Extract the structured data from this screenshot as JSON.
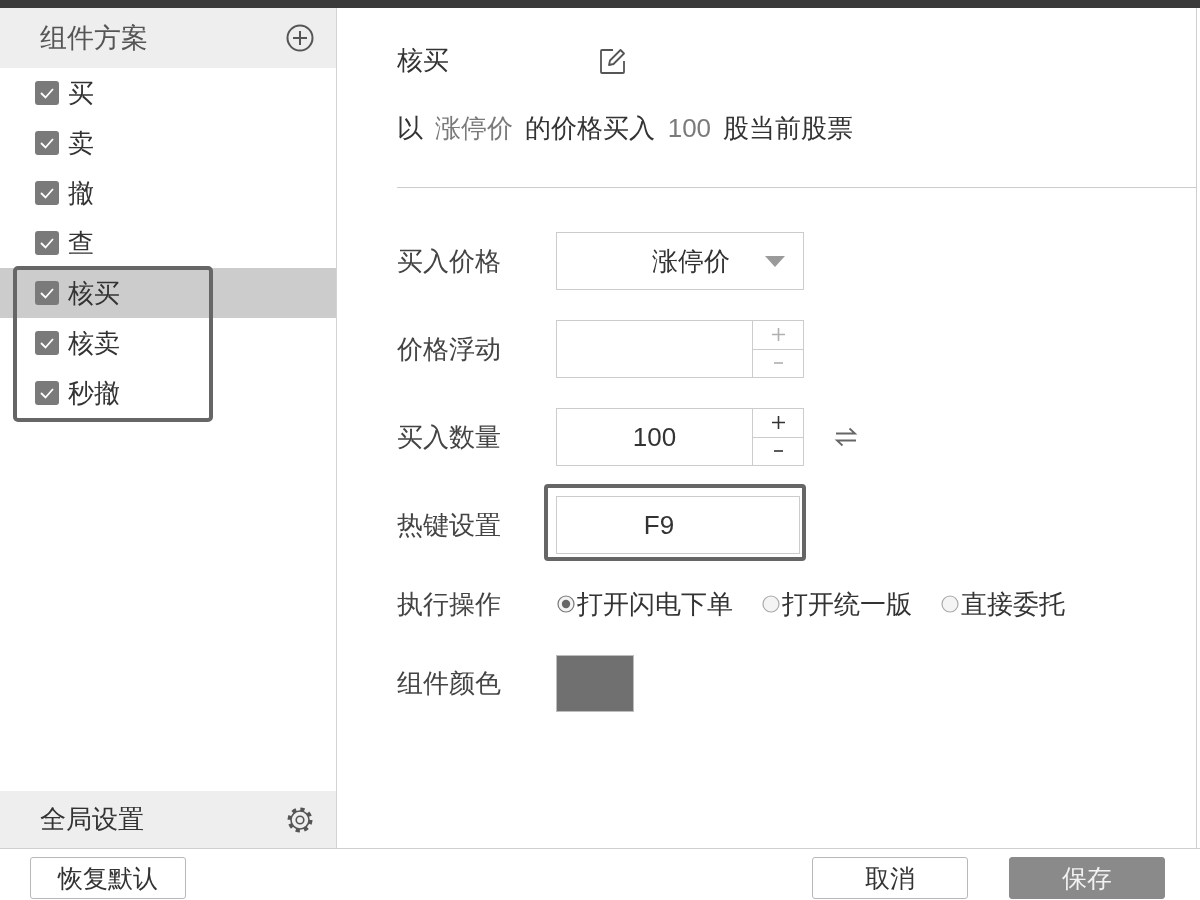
{
  "sidebar": {
    "title": "组件方案",
    "items": [
      {
        "label": "买",
        "checked": true,
        "selected": false,
        "highlighted": false
      },
      {
        "label": "卖",
        "checked": true,
        "selected": false,
        "highlighted": false
      },
      {
        "label": "撤",
        "checked": true,
        "selected": false,
        "highlighted": false
      },
      {
        "label": "查",
        "checked": true,
        "selected": false,
        "highlighted": false
      },
      {
        "label": "核买",
        "checked": true,
        "selected": true,
        "highlighted": true
      },
      {
        "label": "核卖",
        "checked": true,
        "selected": false,
        "highlighted": true
      },
      {
        "label": "秒撤",
        "checked": true,
        "selected": false,
        "highlighted": true
      }
    ],
    "footer": {
      "label": "全局设置"
    }
  },
  "panel": {
    "title": "核买",
    "description": [
      {
        "kind": "text",
        "text": "以 "
      },
      {
        "kind": "value",
        "text": "涨停价"
      },
      {
        "kind": "text",
        "text": " 的价格买入 "
      },
      {
        "kind": "value",
        "text": "100"
      },
      {
        "kind": "text",
        "text": " 股当前股票"
      }
    ],
    "fields": [
      {
        "kind": "dropdown",
        "label": "买入价格",
        "value": "涨停价"
      },
      {
        "kind": "spinner",
        "label": "价格浮动",
        "disabled": true
      },
      {
        "kind": "spinner",
        "label": "买入数量",
        "value": "100",
        "disabled": false,
        "swap": true
      },
      {
        "kind": "hotkey",
        "label": "热键设置",
        "value": "F9",
        "highlighted": true
      },
      {
        "kind": "radio",
        "label": "执行操作",
        "options": [
          {
            "label": "打开闪电下单",
            "selected": true
          },
          {
            "label": "打开统一版",
            "selected": false
          },
          {
            "label": "直接委托",
            "selected": false
          }
        ]
      },
      {
        "kind": "color",
        "label": "组件颜色",
        "color": "#707070"
      }
    ]
  },
  "buttons": [
    {
      "label": "恢复默认",
      "kind": "secondary"
    },
    {
      "label": "取消",
      "kind": "secondary"
    },
    {
      "label": "保存",
      "kind": "primary"
    }
  ]
}
